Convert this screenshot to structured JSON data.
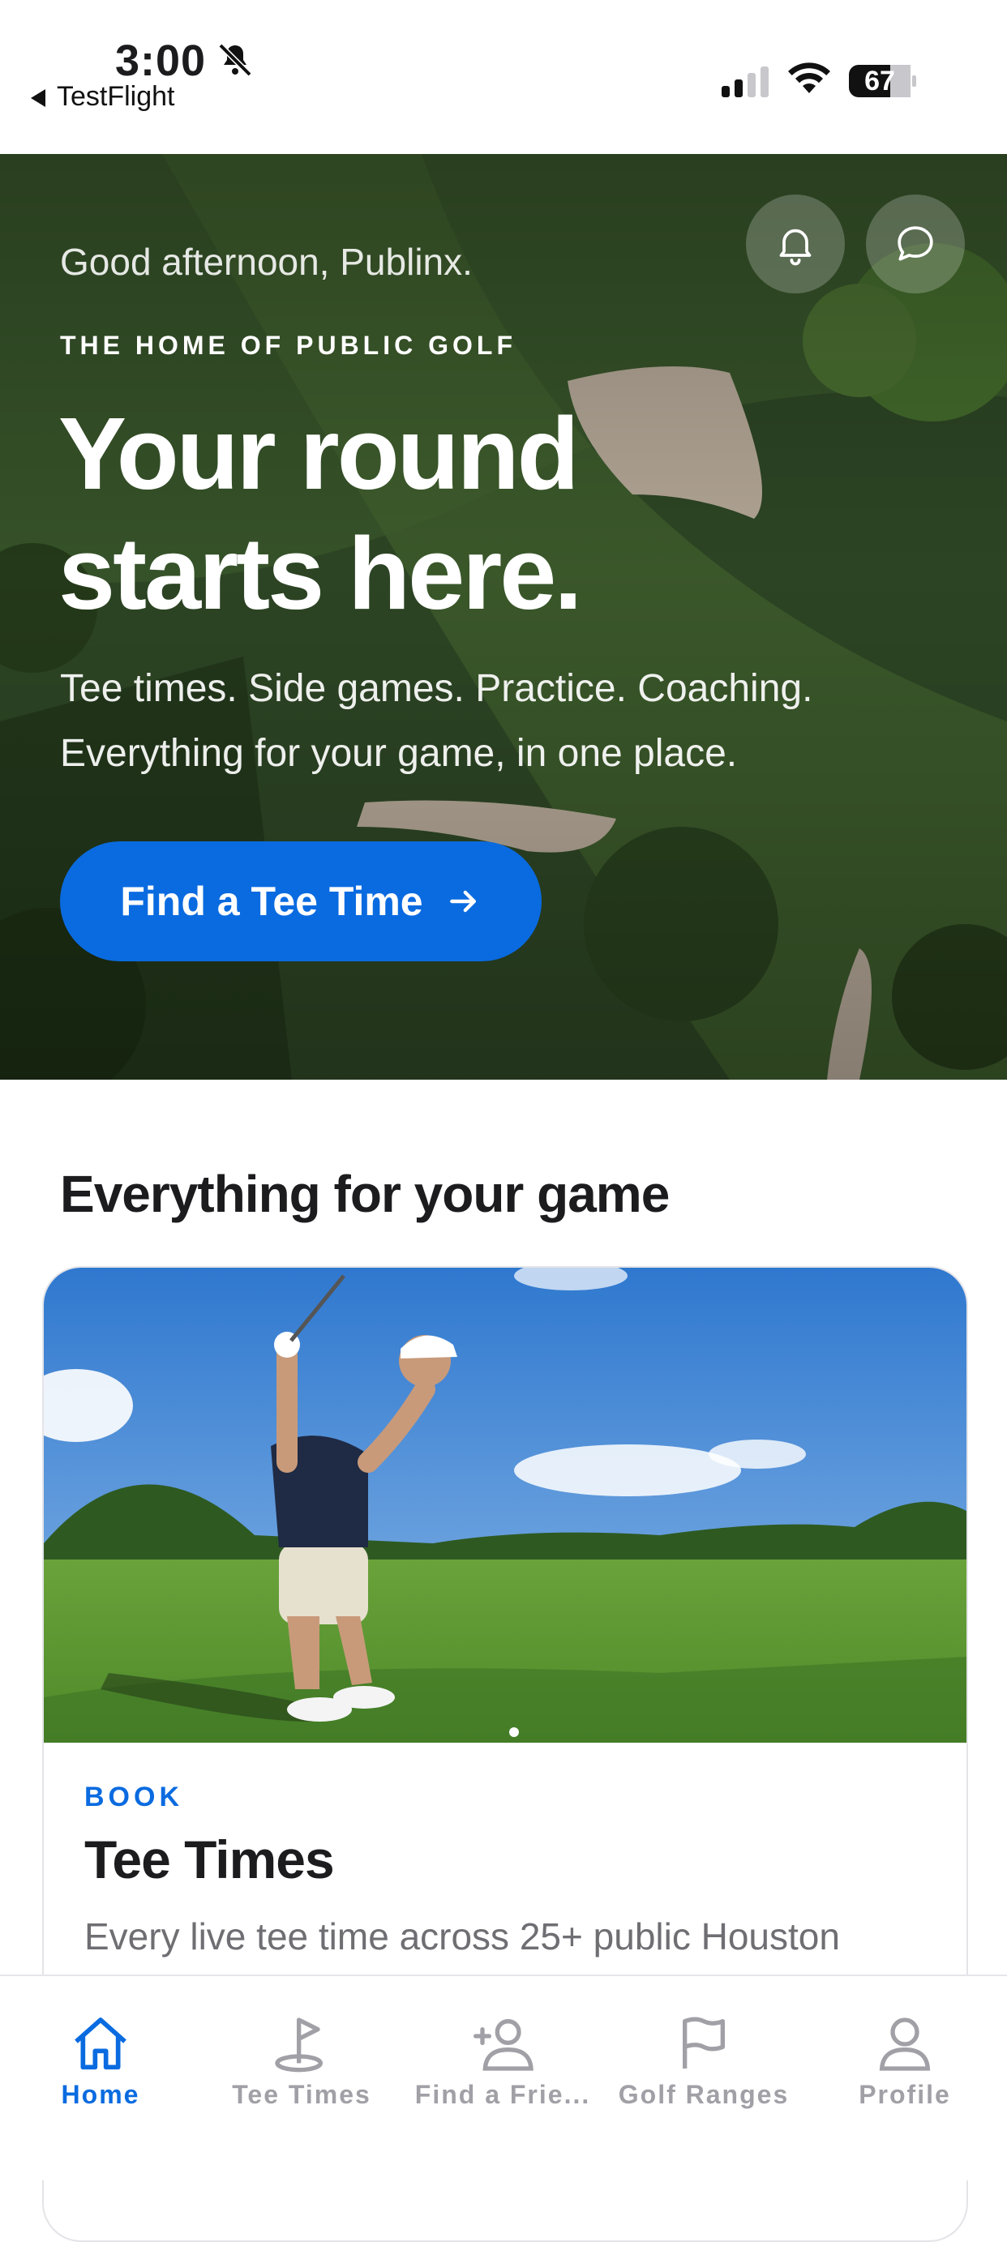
{
  "status_bar": {
    "time": "3:00",
    "back_app": "TestFlight",
    "battery": "67"
  },
  "hero": {
    "greeting": "Good afternoon, Publinx.",
    "eyebrow": "THE HOME OF PUBLIC GOLF",
    "title": "Your round starts here.",
    "subtitle": "Tee times. Side games. Practice. Coaching. Everything for your game, in one place.",
    "cta_label": "Find a Tee Time",
    "notification_icon": "bell-icon",
    "messages_icon": "chat-bubble-icon"
  },
  "section": {
    "title": "Everything for your game"
  },
  "card": {
    "eyebrow": "BOOK",
    "title": "Tee Times",
    "description": "Every live tee time across 25+ public Houston"
  },
  "tab_bar": {
    "items": [
      {
        "label": "Home",
        "icon": "home-icon",
        "active": true
      },
      {
        "label": "Tee Times",
        "icon": "golf-flag-hole-icon",
        "active": false
      },
      {
        "label": "Find a Frie...",
        "icon": "add-friend-icon",
        "active": false
      },
      {
        "label": "Golf Ranges",
        "icon": "flag-icon",
        "active": false
      },
      {
        "label": "Profile",
        "icon": "person-icon",
        "active": false
      }
    ]
  },
  "colors": {
    "accent": "#0a6be0",
    "tab_inactive": "#a0a0a6",
    "text_primary": "#1c1c1e",
    "text_secondary": "#6e6e73"
  }
}
